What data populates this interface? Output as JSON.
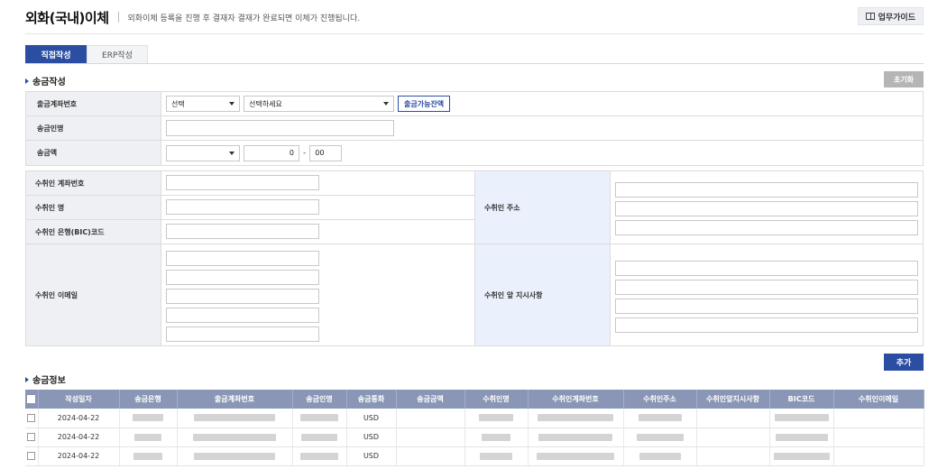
{
  "header": {
    "title": "외화(국내)이체",
    "description": "외화이체 등록을 진행 후 결재자 결재가 완료되면 이체가 진행됩니다.",
    "guide_label": "업무가이드"
  },
  "tabs": [
    {
      "label": "직접작성",
      "active": true
    },
    {
      "label": "ERP작성",
      "active": false
    }
  ],
  "remit_form": {
    "section_title": "송금작성",
    "reset_label": "초기화",
    "rows": {
      "account_label": "출금계좌번호",
      "account_select_1": "선택",
      "account_select_2": "선택하세요",
      "balance_button": "출금가능잔액",
      "sender_label": "송금인명",
      "sender_value": "",
      "amount_label": "송금액",
      "currency_select": "",
      "amount_int": "0",
      "amount_sep": "-",
      "amount_dec": "00"
    }
  },
  "recipient_form": {
    "account_label": "수취인 계좌번호",
    "name_label": "수취인 명",
    "bank_label": "수취인 은행(BIC)코드",
    "email_label": "수취인 이메일",
    "address_label": "수취인 주소",
    "instruction_label": "수취인 앞 지시사항"
  },
  "add_label": "추가",
  "remit_info": {
    "section_title": "송금정보",
    "columns": [
      "작성일자",
      "송금은행",
      "출금계좌번호",
      "송금인명",
      "송금통화",
      "송금금액",
      "수취인명",
      "수취인계좌번호",
      "수취인주소",
      "수취인앞지시사항",
      "BIC코드",
      "수취인이메일"
    ],
    "rows": [
      {
        "date": "2024-04-22",
        "currency": "USD"
      },
      {
        "date": "2024-04-22",
        "currency": "USD"
      },
      {
        "date": "2024-04-22",
        "currency": "USD"
      }
    ]
  },
  "colors": {
    "primary": "#2b4ea3",
    "table_header": "#8a96b5",
    "label_bg": "#eef0f4",
    "label_bg_blue": "#eaf1fc"
  }
}
